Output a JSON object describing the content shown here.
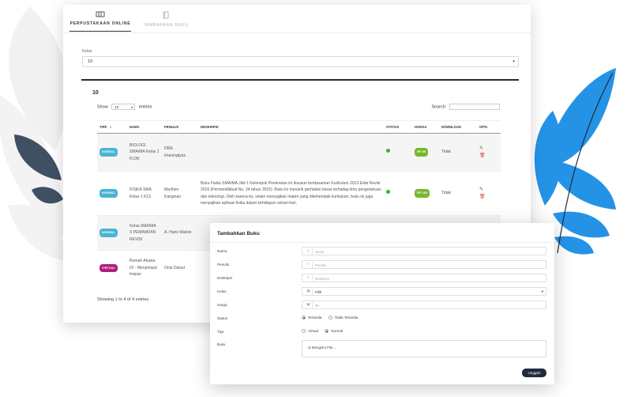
{
  "tabs": [
    {
      "label": "PERPUSTAKAAN ONLINE",
      "active": true
    },
    {
      "label": "TAMBAHKAN BUKU",
      "active": false
    }
  ],
  "filter": {
    "label": "Kelas",
    "value": "10"
  },
  "table_panel": {
    "title": "10",
    "show_prefix": "Show",
    "show_value": "10",
    "show_suffix": "entries",
    "search_label": "Search:",
    "columns": [
      "TIPE",
      "NAMA",
      "PENULIS",
      "DESKRIPSI",
      "STATUS",
      "HARGA",
      "DOWNLOAD",
      "OPSI"
    ],
    "rows": [
      {
        "tipe": "NORMAL",
        "nama": "BIOLOGI SMA/MA Kelas 1 K13N",
        "penulis": "DRA. Imaningtyas",
        "deskripsi": "",
        "status": "available",
        "harga": "RP. 99",
        "download": "Tidak"
      },
      {
        "tipe": "NORMAL",
        "nama": "FISIKA SMA Kelas 1 K13",
        "penulis": "Marthen Kanginan",
        "deskripsi": "Buku Fisika SMA/MA Jilid 1 Kelompok Peminatan ini disusun berdasarkan Kurikulum 2013 Edisi Revisi 2016 (Permendikbud No. 24 tahun 2016). Buku ini menarik perhatian besar terhadap ilmu pengetahuan dan teknologi. Oleh karena itu, selain menyajikan materi yang dikehendaki kurikulum, buku ini juga menyajikan aplikasi fisika dalam kehidupan sehari-hari.",
        "status": "available",
        "harga": "RP. 100",
        "download": "Tidak"
      },
      {
        "tipe": "NORMAL",
        "nama": "Kimia SMA/MA X PEMINATAN REVISI",
        "penulis": "A. Haris Watoni",
        "deskripsi": "",
        "status": "",
        "harga": "",
        "download": ""
      },
      {
        "tipe": "VIRTUAL",
        "nama": "Rumah Akasia #2 - Menjemput Impian",
        "penulis": "Onie Dalust",
        "deskripsi": "",
        "status": "",
        "harga": "",
        "download": ""
      }
    ],
    "footer": "Showing 1 to 4 of 4 entries"
  },
  "modal": {
    "title": "Tambahkan Buku",
    "fields": [
      {
        "label": "Nama",
        "placeholder": "Nama",
        "icon": "book-icon"
      },
      {
        "label": "Penulis",
        "placeholder": "Penulis",
        "icon": "user-icon"
      },
      {
        "label": "Deskripsi",
        "placeholder": "Deskripsi",
        "icon": "text-icon"
      },
      {
        "label": "Kelas",
        "value": "Pilih",
        "icon": "grid-icon"
      },
      {
        "label": "Harga",
        "placeholder": "99",
        "icon": "price-icon"
      }
    ],
    "status": {
      "label": "Status",
      "options": [
        "Tersedia",
        "Tidak Tersedia"
      ],
      "selected": "Tersedia"
    },
    "tipe": {
      "label": "Tipe",
      "options": [
        "Virtual",
        "Normal"
      ],
      "selected": "Normal"
    },
    "buku": {
      "label": "Buku",
      "button": "Mengirim File..."
    },
    "submit": "Unggah"
  },
  "colors": {
    "primary_dark": "#1f2b3f",
    "badge_normal": "#4bb4d6",
    "badge_virtual": "#b21f7b",
    "price_green": "#78b82a",
    "status_green": "#2eb82e",
    "leaf_blue": "#2493e6",
    "leaf_slate": "#3f5063"
  }
}
